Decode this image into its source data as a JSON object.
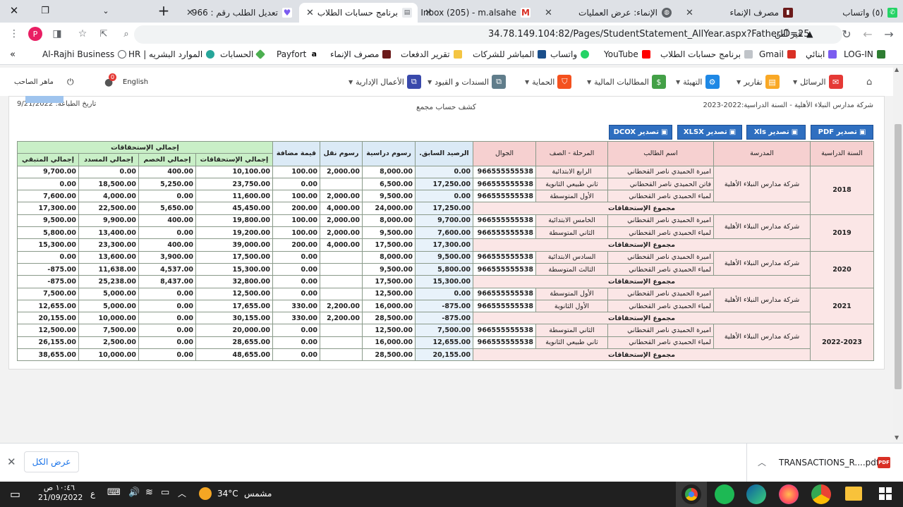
{
  "browser": {
    "tabs": [
      {
        "title": "(٥) واتساب",
        "active": false
      },
      {
        "title": "مصرف الإنماء",
        "active": false
      },
      {
        "title": "الإنماء: عرض العمليات",
        "active": false
      },
      {
        "title": "Inbox (205) - m.alsahe",
        "active": false
      },
      {
        "title": "برنامج حسابات الطلاب",
        "active": true
      },
      {
        "title": "تعديل الطلب رقم : 966",
        "active": false
      }
    ],
    "new_tab": "+",
    "close_glyph": "✕",
    "url": "34.78.149.104:82/Pages/StudentStatement_AllYear.aspx?FatherID=25",
    "security": "غير آمن",
    "profile_initial": "P",
    "bookmarks": [
      "LOG-IN",
      "ابنائي",
      "Gmail",
      "برنامج حسابات الطلاب",
      "YouTube",
      "واتساب",
      "المباشر للشركات",
      "تقرير الدفعات",
      "مصرف الإنماء",
      "Payfort",
      "الحسابات",
      "الموارد البشريه | HR",
      "Al-Rajhi Business"
    ],
    "bookmarks_more": "»"
  },
  "navbar": {
    "items": [
      "الرسائل",
      "تقارير",
      "التهيئة",
      "المطالبات المالية",
      "الحماية",
      "السندات و القيود",
      "الأعمال الإدارية"
    ],
    "language": "English",
    "user": "ماهر الصاحب",
    "notif_count": "0"
  },
  "report": {
    "school_year_header": "شركة مدارس النبلاء الأهلية - السنة الدراسية:2022-2023",
    "title": "كشف حساب مجمع",
    "print_date": "تاريخ الطباعة: 9/21/2022",
    "export_buttons": [
      "تصدير PDF",
      "تصدير Xls",
      "تصدير XLSX",
      "تصدير DCOX"
    ]
  },
  "table": {
    "headers": {
      "year": "السنة الدراسية",
      "school": "المدرسة",
      "student": "اسم الطالب",
      "grade": "المرحلة - الصف",
      "mobile": "الجوال",
      "prev_balance": ".الرصيد السابق",
      "tuition": "رسوم دراسية",
      "transport": "رسوم نقل",
      "vat": "قيمة مضافة",
      "totals_group": "إجمالي الإستحقاقات",
      "total_due": "إجمالي الإستحقاقات",
      "total_discount": "إجمالي الخصم",
      "total_paid": "إجمالي المسدد",
      "total_remaining": "إجمالي المتبقي"
    },
    "totals_label": "مجموع الإستحقاقات",
    "groups": [
      {
        "year": "2018",
        "school": "شركة مدارس النبلاء الأهلية",
        "rows": [
          {
            "student": "اميرة الحميدي ناصر القحطاني",
            "grade": "الرابع الابتدائية",
            "mobile": "966555555538",
            "prev": "0.00",
            "tuition": "8,000.00",
            "transport": "2,000.00",
            "vat": "100.00",
            "due": "10,100.00",
            "discount": "400.00",
            "paid": "0.00",
            "remain": "9,700.00"
          },
          {
            "student": "فاتن الحميدي ناصر القحطاني",
            "grade": "ثاني طبيعي الثانوية",
            "mobile": "966555555538",
            "prev": "17,250.00",
            "tuition": "6,500.00",
            "transport": "",
            "vat": "0.00",
            "due": "23,750.00",
            "discount": "5,250.00",
            "paid": "18,500.00",
            "remain": "0.00"
          },
          {
            "student": "لمياء الحميدي ناصر القحطاني",
            "grade": "الأول المتوسطة",
            "mobile": "966555555538",
            "prev": "0.00",
            "tuition": "9,500.00",
            "transport": "2,000.00",
            "vat": "100.00",
            "due": "11,600.00",
            "discount": "0.00",
            "paid": "4,000.00",
            "remain": "7,600.00"
          }
        ],
        "total": {
          "prev": "17,250.00",
          "tuition": "24,000.00",
          "transport": "4,000.00",
          "vat": "200.00",
          "due": "45,450.00",
          "discount": "5,650.00",
          "paid": "22,500.00",
          "remain": "17,300.00"
        }
      },
      {
        "year": "2019",
        "school": "شركة مدارس النبلاء الأهلية",
        "rows": [
          {
            "student": "اميرة الحميدي ناصر القحطاني",
            "grade": "الخامس الابتدائية",
            "mobile": "966555555538",
            "prev": "9,700.00",
            "tuition": "8,000.00",
            "transport": "2,000.00",
            "vat": "100.00",
            "due": "19,800.00",
            "discount": "400.00",
            "paid": "9,900.00",
            "remain": "9,500.00"
          },
          {
            "student": "لمياء الحميدي ناصر القحطاني",
            "grade": "الثاني المتوسطة",
            "mobile": "966555555538",
            "prev": "7,600.00",
            "tuition": "9,500.00",
            "transport": "2,000.00",
            "vat": "100.00",
            "due": "19,200.00",
            "discount": "0.00",
            "paid": "13,400.00",
            "remain": "5,800.00"
          }
        ],
        "total": {
          "prev": "17,300.00",
          "tuition": "17,500.00",
          "transport": "4,000.00",
          "vat": "200.00",
          "due": "39,000.00",
          "discount": "400.00",
          "paid": "23,300.00",
          "remain": "15,300.00"
        }
      },
      {
        "year": "2020",
        "school": "شركة مدارس النبلاء الأهلية",
        "rows": [
          {
            "student": "اميرة الحميدي ناصر القحطاني",
            "grade": "السادس الابتدائية",
            "mobile": "966555555538",
            "prev": "9,500.00",
            "tuition": "8,000.00",
            "transport": "",
            "vat": "0.00",
            "due": "17,500.00",
            "discount": "3,900.00",
            "paid": "13,600.00",
            "remain": "0.00"
          },
          {
            "student": "لمياء الحميدي ناصر القحطاني",
            "grade": "الثالث المتوسطة",
            "mobile": "966555555538",
            "prev": "5,800.00",
            "tuition": "9,500.00",
            "transport": "",
            "vat": "0.00",
            "due": "15,300.00",
            "discount": "4,537.00",
            "paid": "11,638.00",
            "remain": "-875.00"
          }
        ],
        "total": {
          "prev": "15,300.00",
          "tuition": "17,500.00",
          "transport": "",
          "vat": "0.00",
          "due": "32,800.00",
          "discount": "8,437.00",
          "paid": "25,238.00",
          "remain": "-875.00"
        }
      },
      {
        "year": "2021",
        "school": "شركة مدارس النبلاء الأهلية",
        "rows": [
          {
            "student": "اميرة الحميدي ناصر القحطاني",
            "grade": "الأول المتوسطة",
            "mobile": "966555555538",
            "prev": "0.00",
            "tuition": "12,500.00",
            "transport": "",
            "vat": "0.00",
            "due": "12,500.00",
            "discount": "0.00",
            "paid": "5,000.00",
            "remain": "7,500.00"
          },
          {
            "student": "لمياء الحميدي ناصر القحطاني",
            "grade": "الأول الثانوية",
            "mobile": "966555555538",
            "prev": "-875.00",
            "tuition": "16,000.00",
            "transport": "2,200.00",
            "vat": "330.00",
            "due": "17,655.00",
            "discount": "0.00",
            "paid": "5,000.00",
            "remain": "12,655.00"
          }
        ],
        "total": {
          "prev": "-875.00",
          "tuition": "28,500.00",
          "transport": "2,200.00",
          "vat": "330.00",
          "due": "30,155.00",
          "discount": "0.00",
          "paid": "10,000.00",
          "remain": "20,155.00"
        }
      },
      {
        "year": "2022-2023",
        "school": "شركة مدارس النبلاء الأهلية",
        "rows": [
          {
            "student": "اميرة الحميدي ناصر القحطاني",
            "grade": "الثاني المتوسطة",
            "mobile": "966555555538",
            "prev": "7,500.00",
            "tuition": "12,500.00",
            "transport": "",
            "vat": "0.00",
            "due": "20,000.00",
            "discount": "0.00",
            "paid": "7,500.00",
            "remain": "12,500.00"
          },
          {
            "student": "لمياء الحميدي ناصر القحطاني",
            "grade": "ثاني طبيعي الثانوية",
            "mobile": "966555555538",
            "prev": "12,655.00",
            "tuition": "16,000.00",
            "transport": "",
            "vat": "0.00",
            "due": "28,655.00",
            "discount": "0.00",
            "paid": "2,500.00",
            "remain": "26,155.00"
          }
        ],
        "total": {
          "prev": "20,155.00",
          "tuition": "28,500.00",
          "transport": "",
          "vat": "0.00",
          "due": "48,655.00",
          "discount": "0.00",
          "paid": "10,000.00",
          "remain": "38,655.00"
        }
      }
    ]
  },
  "downloads": {
    "show_all": "عرض الكل",
    "file": "TRANSACTIONS_R....pdf",
    "file_badge": "PDF"
  },
  "taskbar": {
    "weather": "34°C",
    "weather_text": "مشمس",
    "time": "١٠:٤٦ ص",
    "date": "21/09/2022",
    "lang": "ع"
  },
  "colors": {
    "export": "#2f6fc0",
    "green_header": "#c9efc7",
    "pink_header": "#f6d0d0"
  }
}
